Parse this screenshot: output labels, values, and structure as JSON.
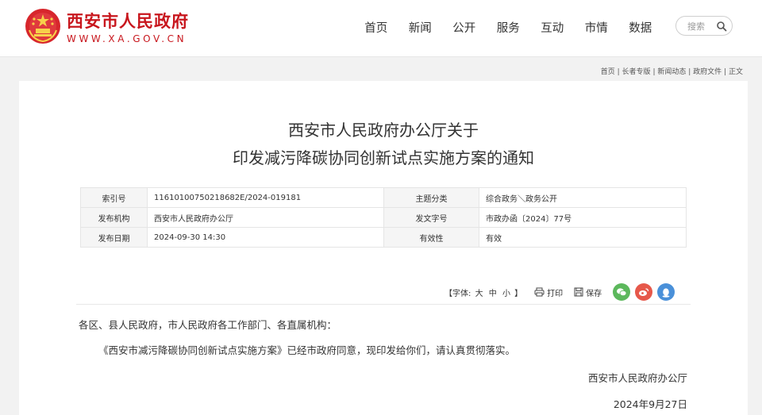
{
  "header": {
    "site_name": "西安市人民政府",
    "site_url": "WWW.XA.GOV.CN",
    "nav": [
      "首页",
      "新闻",
      "公开",
      "服务",
      "互动",
      "市情",
      "数据"
    ],
    "search": {
      "placeholder": "搜索",
      "icon": "search-icon"
    }
  },
  "breadcrumb": {
    "items": [
      "首页",
      "长者专版",
      "新闻动态",
      "政府文件",
      "正文"
    ],
    "separator": "|"
  },
  "article": {
    "title_line1": "西安市人民政府办公厅关于",
    "title_line2": "印发减污降碳协同创新试点实施方案的通知",
    "meta": {
      "index_label": "索引号",
      "index_value": "11610100750218682E/2024-019181",
      "topic_label": "主题分类",
      "topic_value": "综合政务＼政务公开",
      "issuer_label": "发布机构",
      "issuer_value": "西安市人民政府办公厅",
      "doc_no_label": "发文字号",
      "doc_no_value": "市政办函〔2024〕77号",
      "date_label": "发布日期",
      "date_value": "2024-09-30 14:30",
      "validity_label": "有效性",
      "validity_value": "有效"
    },
    "tools": {
      "font_prefix": "【字体:",
      "font_large": "大",
      "font_medium": "中",
      "font_small": "小",
      "font_suffix": "】",
      "print": "打印",
      "save": "保存",
      "share": [
        "wechat-icon",
        "weibo-icon",
        "qq-icon"
      ]
    },
    "salutation": "各区、县人民政府，市人民政府各工作部门、各直属机构：",
    "body": "《西安市减污降碳协同创新试点实施方案》已经市政府同意，现印发给你们，请认真贯彻落实。",
    "signature": "西安市人民政府办公厅",
    "sign_date": "2024年9月27日"
  },
  "colors": {
    "brand_red": "#c8161d",
    "wechat": "#5cb85c",
    "weibo": "#e6584a",
    "qq": "#4a90d9"
  }
}
